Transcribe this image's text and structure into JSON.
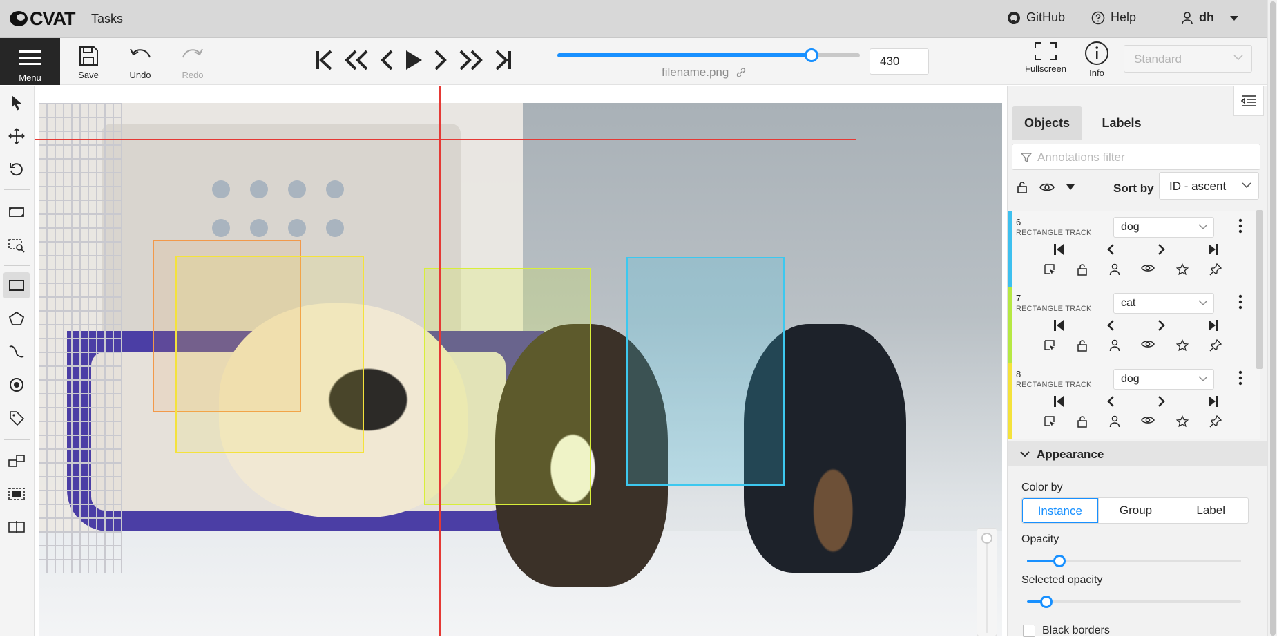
{
  "header": {
    "logo_text": "CVAT",
    "tasks_label": "Tasks",
    "github_label": "GitHub",
    "help_label": "Help",
    "user_name": "dh"
  },
  "toolbar": {
    "menu_label": "Menu",
    "save_label": "Save",
    "undo_label": "Undo",
    "redo_label": "Redo",
    "frame_number": "430",
    "filename": "filename.png",
    "fullscreen_label": "Fullscreen",
    "info_label": "Info",
    "workspace": "Standard",
    "frame_progress": 0.84
  },
  "sidebar": {
    "tabs": [
      "Objects",
      "Labels"
    ],
    "filter_placeholder": "Annotations filter",
    "sort_label": "Sort by",
    "sort_value": "ID - ascent",
    "objects": [
      {
        "id": "6",
        "type": "RECTANGLE TRACK",
        "label": "dog",
        "color": "#3dc0ef"
      },
      {
        "id": "7",
        "type": "RECTANGLE TRACK",
        "label": "cat",
        "color": "#b6e843"
      },
      {
        "id": "8",
        "type": "RECTANGLE TRACK",
        "label": "dog",
        "color": "#f4e23c"
      }
    ],
    "appearance": {
      "title": "Appearance",
      "color_by_label": "Color by",
      "color_by_options": [
        "Instance",
        "Group",
        "Label"
      ],
      "color_by_selected": "Instance",
      "opacity_label": "Opacity",
      "opacity_value": 0.15,
      "selected_opacity_label": "Selected opacity",
      "selected_opacity_value": 0.09,
      "black_borders_label": "Black borders"
    }
  },
  "colors": {
    "accent": "#1890ff",
    "crosshair": "#e53935",
    "menu_bg": "#262626"
  }
}
